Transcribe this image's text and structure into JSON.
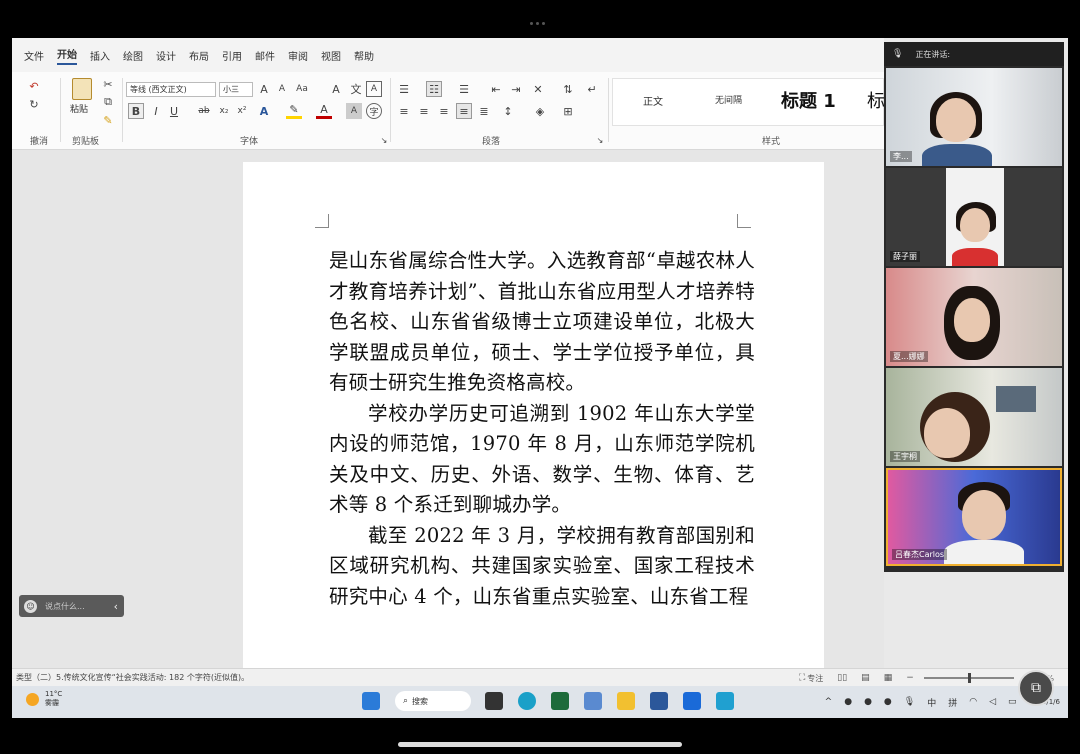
{
  "ribbon": {
    "tabs": [
      "文件",
      "开始",
      "插入",
      "绘图",
      "设计",
      "布局",
      "引用",
      "邮件",
      "审阅",
      "视图",
      "帮助"
    ],
    "active_tab": "开始",
    "groups": {
      "undo": "撤消",
      "clipboard": "剪贴板",
      "paste": "粘贴",
      "font": "字体",
      "paragraph": "段落",
      "styles": "样式"
    },
    "font_name": "等线 (西文正文)",
    "font_size": "小三",
    "styles": [
      "正文",
      "无间隔",
      "标题 1",
      "标"
    ]
  },
  "document": {
    "paragraphs": [
      "是山东省属综合性大学。入选教育部“卓越农林人才教育培养计划”、首批山东省应用型人才培养特色名校、山东省省级博士立项建设单位，北极大学联盟成员单位，硕士、学士学位授予单位，具有硕士研究生推免资格高校。",
      "学校办学历史可追溯到 1902 年山东大学堂内设的师范馆，1970 年 8 月，山东师范学院机关及中文、历史、外语、数学、生物、体育、艺术等 8 个系迁到聊城办学。",
      "截至 2022 年 3 月，学校拥有教育部国别和区域研究机构、共建国家实验室、国家工程技术研究中心 4 个，山东省重点实验室、山东省工程"
    ]
  },
  "floating_toolbar": {
    "label": "说点什么..."
  },
  "meeting": {
    "header": "正在讲话:",
    "participants": [
      {
        "name": "李..."
      },
      {
        "name": "薛子丽"
      },
      {
        "name": "夏...娜娜"
      },
      {
        "name": "王宇桐"
      },
      {
        "name": "吕春杰Carlos"
      }
    ]
  },
  "statusbar": {
    "text": "类型（二）5.传统文化宣传“社会实践活动: 182 个字符(近似值)。",
    "focus": "专注",
    "zoom": "0%"
  },
  "taskbar": {
    "weather_temp": "11°C",
    "weather_desc": "雾霾",
    "search": "搜索",
    "ime1": "中",
    "ime2": "拼",
    "date": "2023/1/6"
  },
  "colors": {
    "word_blue": "#2b579a",
    "font_red": "#c00000",
    "highlight_yellow": "#ffd400"
  }
}
